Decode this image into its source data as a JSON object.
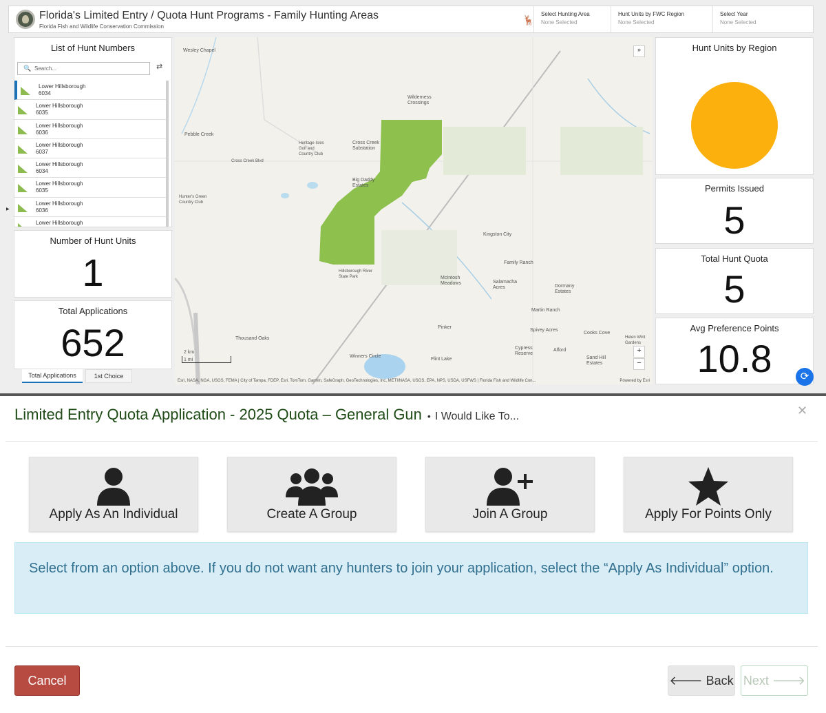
{
  "header": {
    "title": "Florida's Limited Entry / Quota Hunt Programs - Family Hunting Areas",
    "subtitle": "Florida Fish and Wildlife Conservation Commission",
    "selectors": [
      {
        "label": "Select Hunting Area",
        "value": "None Selected"
      },
      {
        "label": "Hunt Units by FWC Region",
        "value": "None Selected"
      },
      {
        "label": "Select Year",
        "value": "None Selected"
      }
    ]
  },
  "hunt_list": {
    "title": "List of Hunt Numbers",
    "search_placeholder": "Search...",
    "items": [
      {
        "name": "Lower Hillsborough",
        "number": "6034"
      },
      {
        "name": "Lower Hillsborough",
        "number": "6035"
      },
      {
        "name": "Lower Hillsborough",
        "number": "6036"
      },
      {
        "name": "Lower Hillsborough",
        "number": "6037"
      },
      {
        "name": "Lower Hillsborough",
        "number": "6034"
      },
      {
        "name": "Lower Hillsborough",
        "number": "6035"
      },
      {
        "name": "Lower Hillsborough",
        "number": "6036"
      },
      {
        "name": "Lower Hillsborough",
        "number": ""
      }
    ]
  },
  "stats": {
    "hunt_units_title": "Number of Hunt Units",
    "hunt_units_value": "1",
    "applications_title": "Total Applications",
    "applications_value": "652",
    "tabs": [
      "Total Applications",
      "1st Choice"
    ],
    "region_title": "Hunt Units by Region",
    "region_color": "#fbb00e",
    "permits_title": "Permits Issued",
    "permits_value": "5",
    "quota_title": "Total Hunt Quota",
    "quota_value": "5",
    "pref_title": "Avg Preference Points",
    "pref_value": "10.8"
  },
  "map": {
    "labels": [
      "Wesley Chapel",
      "Pebble Creek",
      "Wilderness Crossings",
      "Cross Creek Substation",
      "Heritage Isles Golf and Country Club",
      "Big Daddy Estates",
      "Hunter's Green Country Club",
      "Hillsborough River State Park",
      "Kingston City",
      "Family Ranch",
      "McIntosh Meadows",
      "Salamacha Acres",
      "Dormany Estates",
      "Martin Ranch",
      "Spivey Acres",
      "Cooks Cove",
      "Thousand Oaks",
      "Pinker",
      "Cypress Reserve",
      "Alford",
      "Sand Hill Estates",
      "Helen Wint Gardens",
      "Flint Lake",
      "Winners Circle",
      "Cross Creek Blvd"
    ],
    "scale_km": "2 km",
    "scale_mi": "1 mi",
    "attribution": "Esri, NASA, NGA, USGS, FEMA | City of Tampa, FDEP, Esri, TomTom, Garmin, SafeGraph, GeoTechnologies, Inc, METI/NASA, USGS, EPA, NPS, USDA, USFWS | Florida Fish and Wildlife Con...",
    "powered": "Powered by Esri",
    "area_color": "#8dc04d"
  },
  "modal": {
    "title": "Limited Entry Quota Application - 2025 Quota – General Gun",
    "subtitle": "I Would Like To...",
    "options": [
      {
        "label": "Apply As An Individual",
        "icon": "person-icon"
      },
      {
        "label": "Create A Group",
        "icon": "group-icon"
      },
      {
        "label": "Join A Group",
        "icon": "person-add-icon"
      },
      {
        "label": "Apply For Points Only",
        "icon": "star-icon"
      }
    ],
    "info": "Select from an option above. If you do not want any hunters to join your application, select the “Apply As Individual” option.",
    "cancel": "Cancel",
    "back": "Back",
    "next": "Next"
  }
}
